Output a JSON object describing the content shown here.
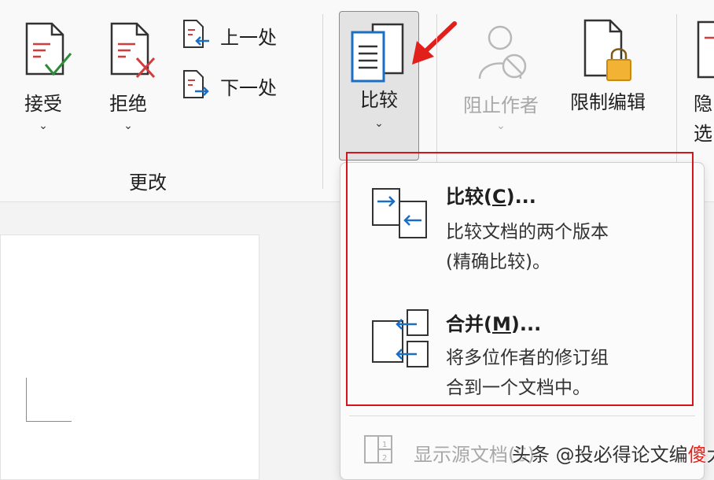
{
  "ribbon": {
    "changes_group": {
      "accept_label": "接受",
      "reject_label": "拒绝",
      "previous_label": "上一处",
      "next_label": "下一处",
      "group_label": "更改"
    },
    "compare_group": {
      "compare_label": "比较"
    },
    "protect_group": {
      "block_authors_label": "阻止作者",
      "restrict_editing_label": "限制编辑",
      "hide_label_partial": "隐",
      "extra_char": "选"
    }
  },
  "compare_menu": {
    "items": [
      {
        "title_prefix": "比较(",
        "title_key": "C",
        "title_suffix": ")...",
        "desc_line1": "比较文档的两个版本",
        "desc_line2": "(精确比较)。"
      },
      {
        "title_prefix": "合并(",
        "title_key": "M",
        "title_suffix": ")...",
        "desc_line1": "将多位作者的修订组",
        "desc_line2": "合到一个文档中。"
      }
    ],
    "show_source_label": "显示源文档(S)"
  },
  "watermark": {
    "prefix": "头条 @投必得论文编",
    "highlight": "傻",
    "suffix": "大方"
  },
  "colors": {
    "accent_red": "#d4161c",
    "icon_blue": "#1a6fc4",
    "lock_yellow": "#f2b233"
  }
}
